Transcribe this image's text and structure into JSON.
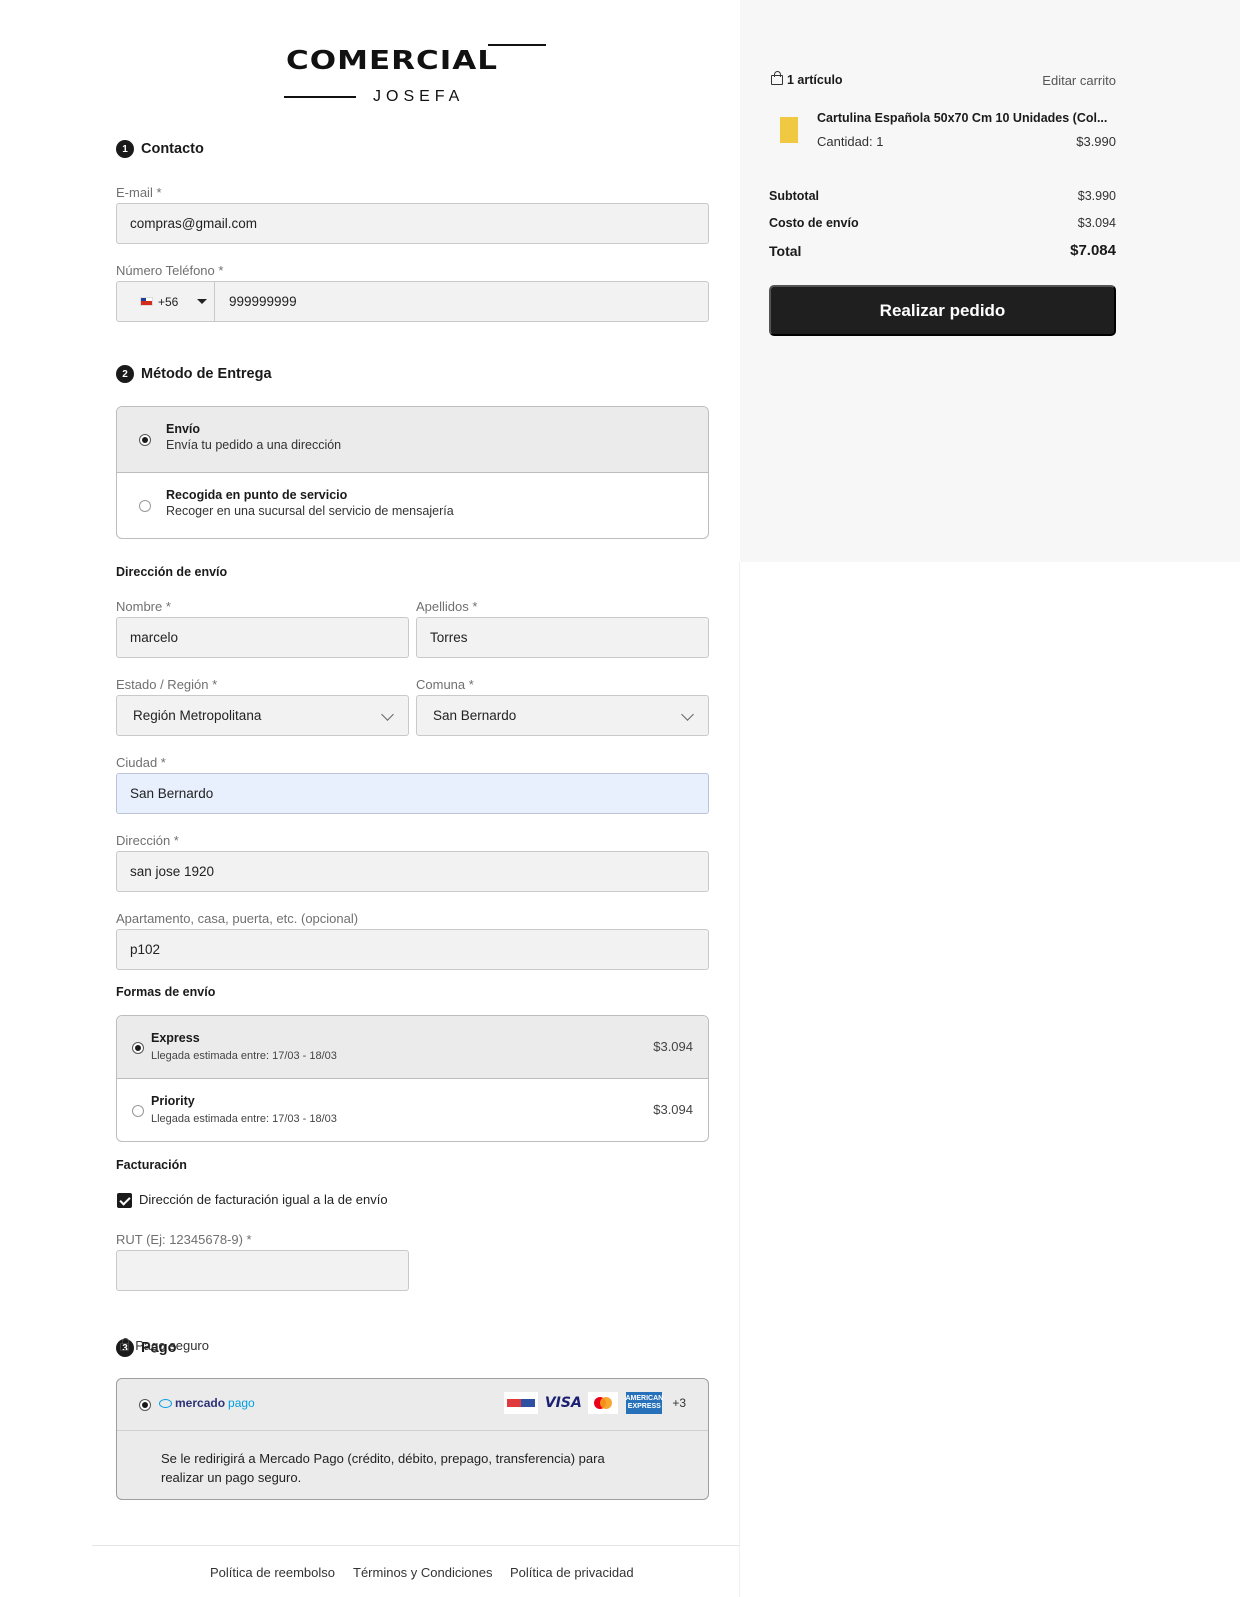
{
  "logo": {
    "main": "COMERCIAL",
    "sub": "JOSEFA"
  },
  "contact": {
    "step": "1",
    "title": "Contacto",
    "email_label": "E-mail *",
    "email_value": "compras@gmail.com",
    "phone_label": "Número Teléfono *",
    "phone_code": "+56",
    "phone_value": "999999999"
  },
  "delivery": {
    "step": "2",
    "title": "Método de Entrega",
    "options": [
      {
        "title": "Envío",
        "subtitle": "Envía tu pedido a una dirección",
        "selected": true
      },
      {
        "title": "Recogida en punto de servicio",
        "subtitle": "Recoger en una sucursal del servicio de mensajería",
        "selected": false
      }
    ]
  },
  "address": {
    "heading": "Dirección de envío",
    "first_name_label": "Nombre *",
    "first_name_value": "marcelo",
    "last_name_label": "Apellidos *",
    "last_name_value": "Torres",
    "region_label": "Estado / Región *",
    "region_value": "Región Metropolitana",
    "comuna_label": "Comuna *",
    "comuna_value": "San Bernardo",
    "city_label": "Ciudad *",
    "city_value": "San Bernardo",
    "street_label": "Dirección *",
    "street_value": "san jose 1920",
    "apt_label": "Apartamento, casa, puerta, etc. (opcional)",
    "apt_value": "p102"
  },
  "shipping": {
    "heading": "Formas de envío",
    "options": [
      {
        "title": "Express",
        "subtitle": "Llegada estimada entre: 17/03 - 18/03",
        "price": "$3.094",
        "selected": true
      },
      {
        "title": "Priority",
        "subtitle": "Llegada estimada entre: 17/03 - 18/03",
        "price": "$3.094",
        "selected": false
      }
    ]
  },
  "billing": {
    "heading": "Facturación",
    "same_address_label": "Dirección de facturación igual a la de envío",
    "same_address_checked": true,
    "rut_label": "RUT (Ej: 12345678-9) *",
    "rut_value": ""
  },
  "payment": {
    "step": "3",
    "title": "Pago",
    "secure_label": "Pago seguro",
    "provider_word1": "mercado",
    "provider_word2": "pago",
    "visa_label": "VISA",
    "amex_label": "AMERICAN EXPRESS",
    "more_cards": "+3",
    "description": "Se le redirigirá a Mercado Pago (crédito, débito, prepago, transferencia) para realizar un pago seguro."
  },
  "footer": {
    "links": [
      "Política de reembolso",
      "Términos y Condiciones",
      "Política de privacidad"
    ]
  },
  "summary": {
    "items_count": "1 artículo",
    "edit_cart": "Editar carrito",
    "product_name": "Cartulina Española 50x70 Cm 10 Unidades (Col...",
    "product_qty": "Cantidad: 1",
    "product_price": "$3.990",
    "subtotal_label": "Subtotal",
    "subtotal_value": "$3.990",
    "shipping_label": "Costo de envío",
    "shipping_value": "$3.094",
    "total_label": "Total",
    "total_value": "$7.084",
    "order_button": "Realizar pedido"
  },
  "colors": {
    "primary": "#1f1f1f",
    "field_bg": "#f2f2f2",
    "autofill_bg": "#e8f0fe",
    "summary_bg": "#f7f7f7",
    "product_thumb": "#f1c842"
  }
}
